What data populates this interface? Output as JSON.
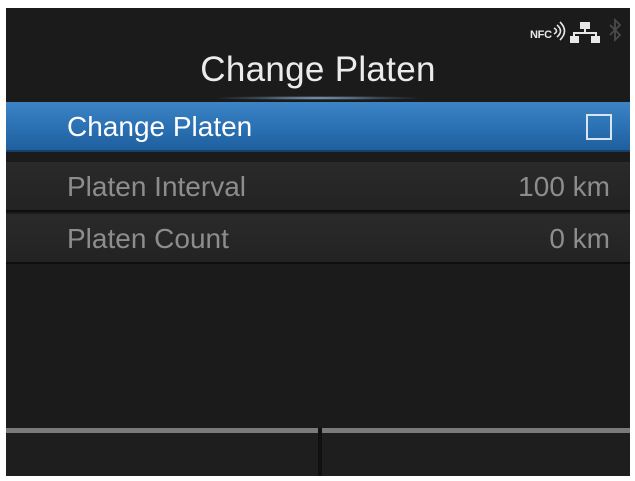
{
  "status_bar": {
    "nfc_label": "NFC",
    "icons": [
      "nfc-icon",
      "network-icon",
      "bluetooth-icon"
    ]
  },
  "header": {
    "title": "Change Platen"
  },
  "menu": {
    "items": [
      {
        "label": "Change Platen",
        "control": "checkbox",
        "checked": false,
        "selected": true
      },
      {
        "label": "Platen Interval",
        "value": "100 km",
        "enabled": false
      },
      {
        "label": "Platen Count",
        "value": "0 km",
        "enabled": false
      }
    ]
  },
  "softkeys": {
    "left_label": "",
    "right_label": ""
  },
  "colors": {
    "screen_background": "#1b1b1b",
    "selection": "#2a70b2",
    "text_primary": "#ececec",
    "text_disabled": "#8d8d8d",
    "softkey_border": "#7a7a7a"
  }
}
